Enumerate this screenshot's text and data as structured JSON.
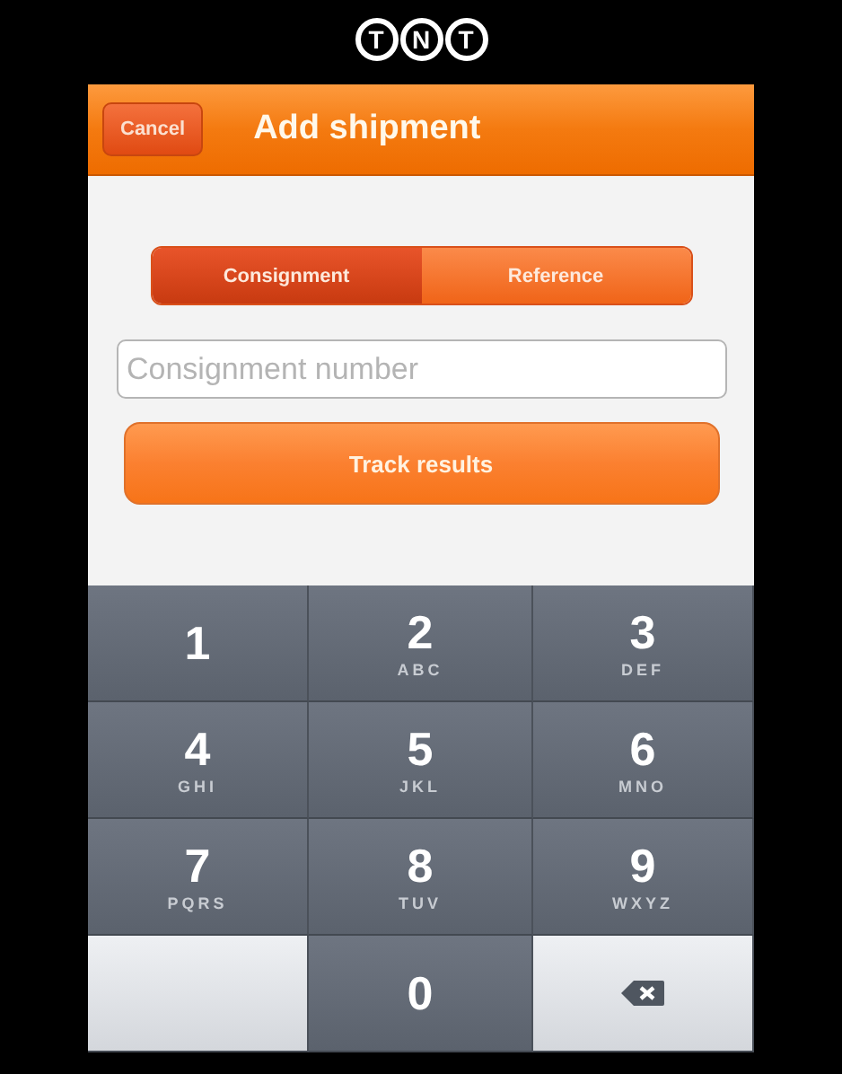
{
  "logo": [
    "T",
    "N",
    "T"
  ],
  "nav_bar": {
    "cancel": "Cancel",
    "title": "Add shipment"
  },
  "segments": [
    {
      "label": "Consignment",
      "selected": true
    },
    {
      "label": "Reference",
      "selected": false
    }
  ],
  "search": {
    "placeholder": "Consignment number"
  },
  "track_button": "Track results",
  "keypad": [
    {
      "kind": "digit",
      "digit": "1"
    },
    {
      "kind": "digit",
      "digit": "2",
      "letters": "ABC"
    },
    {
      "kind": "digit",
      "digit": "3",
      "letters": "DEF"
    },
    {
      "kind": "digit",
      "digit": "4",
      "letters": "GHI"
    },
    {
      "kind": "digit",
      "digit": "5",
      "letters": "JKL"
    },
    {
      "kind": "digit",
      "digit": "6",
      "letters": "MNO"
    },
    {
      "kind": "digit",
      "digit": "7",
      "letters": "PQRS"
    },
    {
      "kind": "digit",
      "digit": "8",
      "letters": "TUV"
    },
    {
      "kind": "digit",
      "digit": "9",
      "letters": "WXYZ"
    },
    {
      "kind": "blank"
    },
    {
      "kind": "digit",
      "digit": "0"
    },
    {
      "kind": "delete"
    }
  ]
}
